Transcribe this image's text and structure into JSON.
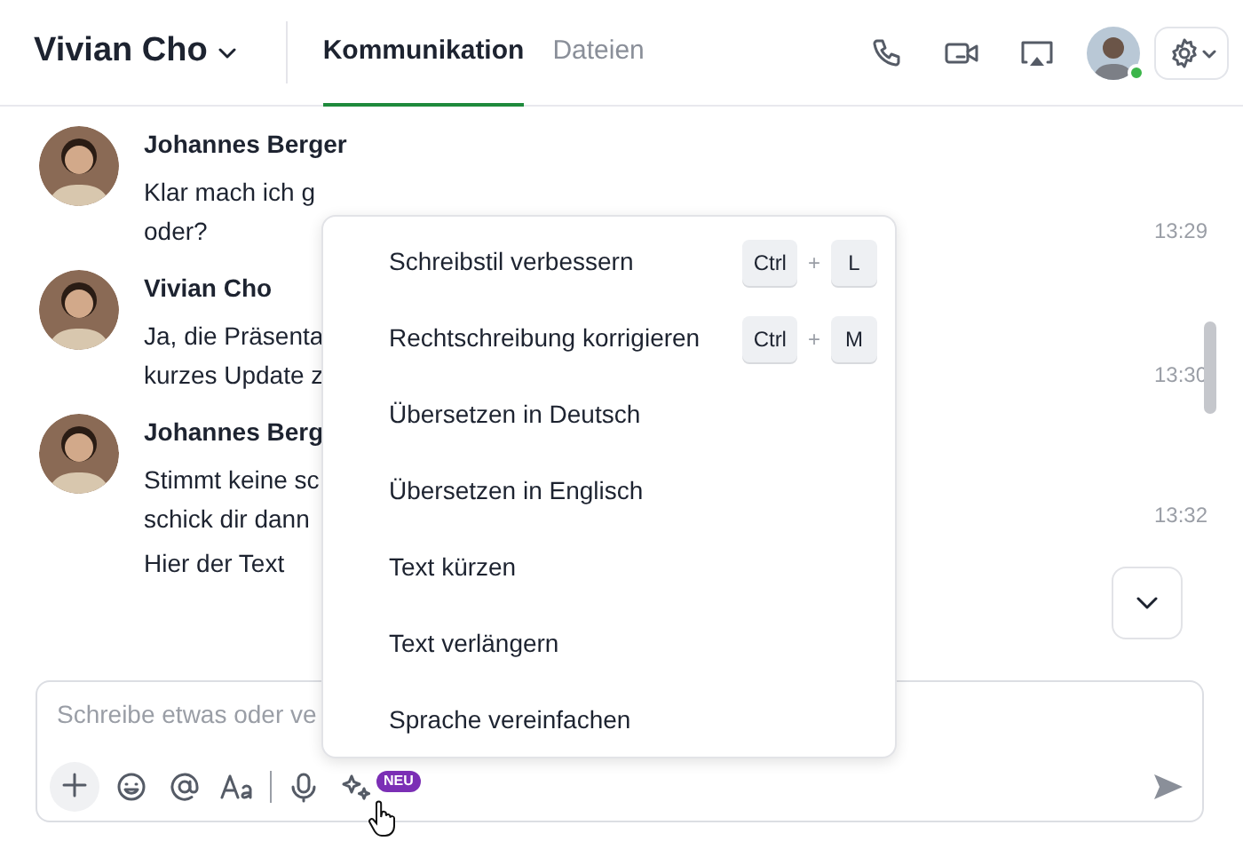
{
  "header": {
    "contact": "Vivian Cho",
    "tabs": [
      {
        "label": "Kommunikation",
        "selected": true
      },
      {
        "label": "Dateien",
        "selected": false
      }
    ],
    "presence_online": true
  },
  "messages": [
    {
      "sender": "Johannes Berger",
      "lines": [
        "Klar mach ich g",
        "oder?"
      ],
      "times": [
        "13:29"
      ]
    },
    {
      "sender": "Vivian Cho",
      "lines": [
        "Ja, die Präsenta",
        "kurzes Update z"
      ],
      "times": [
        "13:30"
      ]
    },
    {
      "sender": "Johannes Berg",
      "lines": [
        "Stimmt keine sc",
        "schick dir dann",
        "Hier der Text"
      ],
      "times": [
        "13:32"
      ]
    }
  ],
  "menu": [
    {
      "label": "Schreibstil verbessern",
      "keys": [
        "Ctrl",
        "L"
      ],
      "joiner": "+"
    },
    {
      "label": "Rechtschreibung korrigieren",
      "keys": [
        "Ctrl",
        "M"
      ],
      "joiner": "+"
    },
    {
      "label": "Übersetzen in Deutsch"
    },
    {
      "label": "Übersetzen in Englisch"
    },
    {
      "label": "Text kürzen"
    },
    {
      "label": "Text verlängern"
    },
    {
      "label": "Sprache vereinfachen"
    }
  ],
  "composer": {
    "placeholder": "Schreibe etwas oder ve",
    "badge": "NEU"
  }
}
